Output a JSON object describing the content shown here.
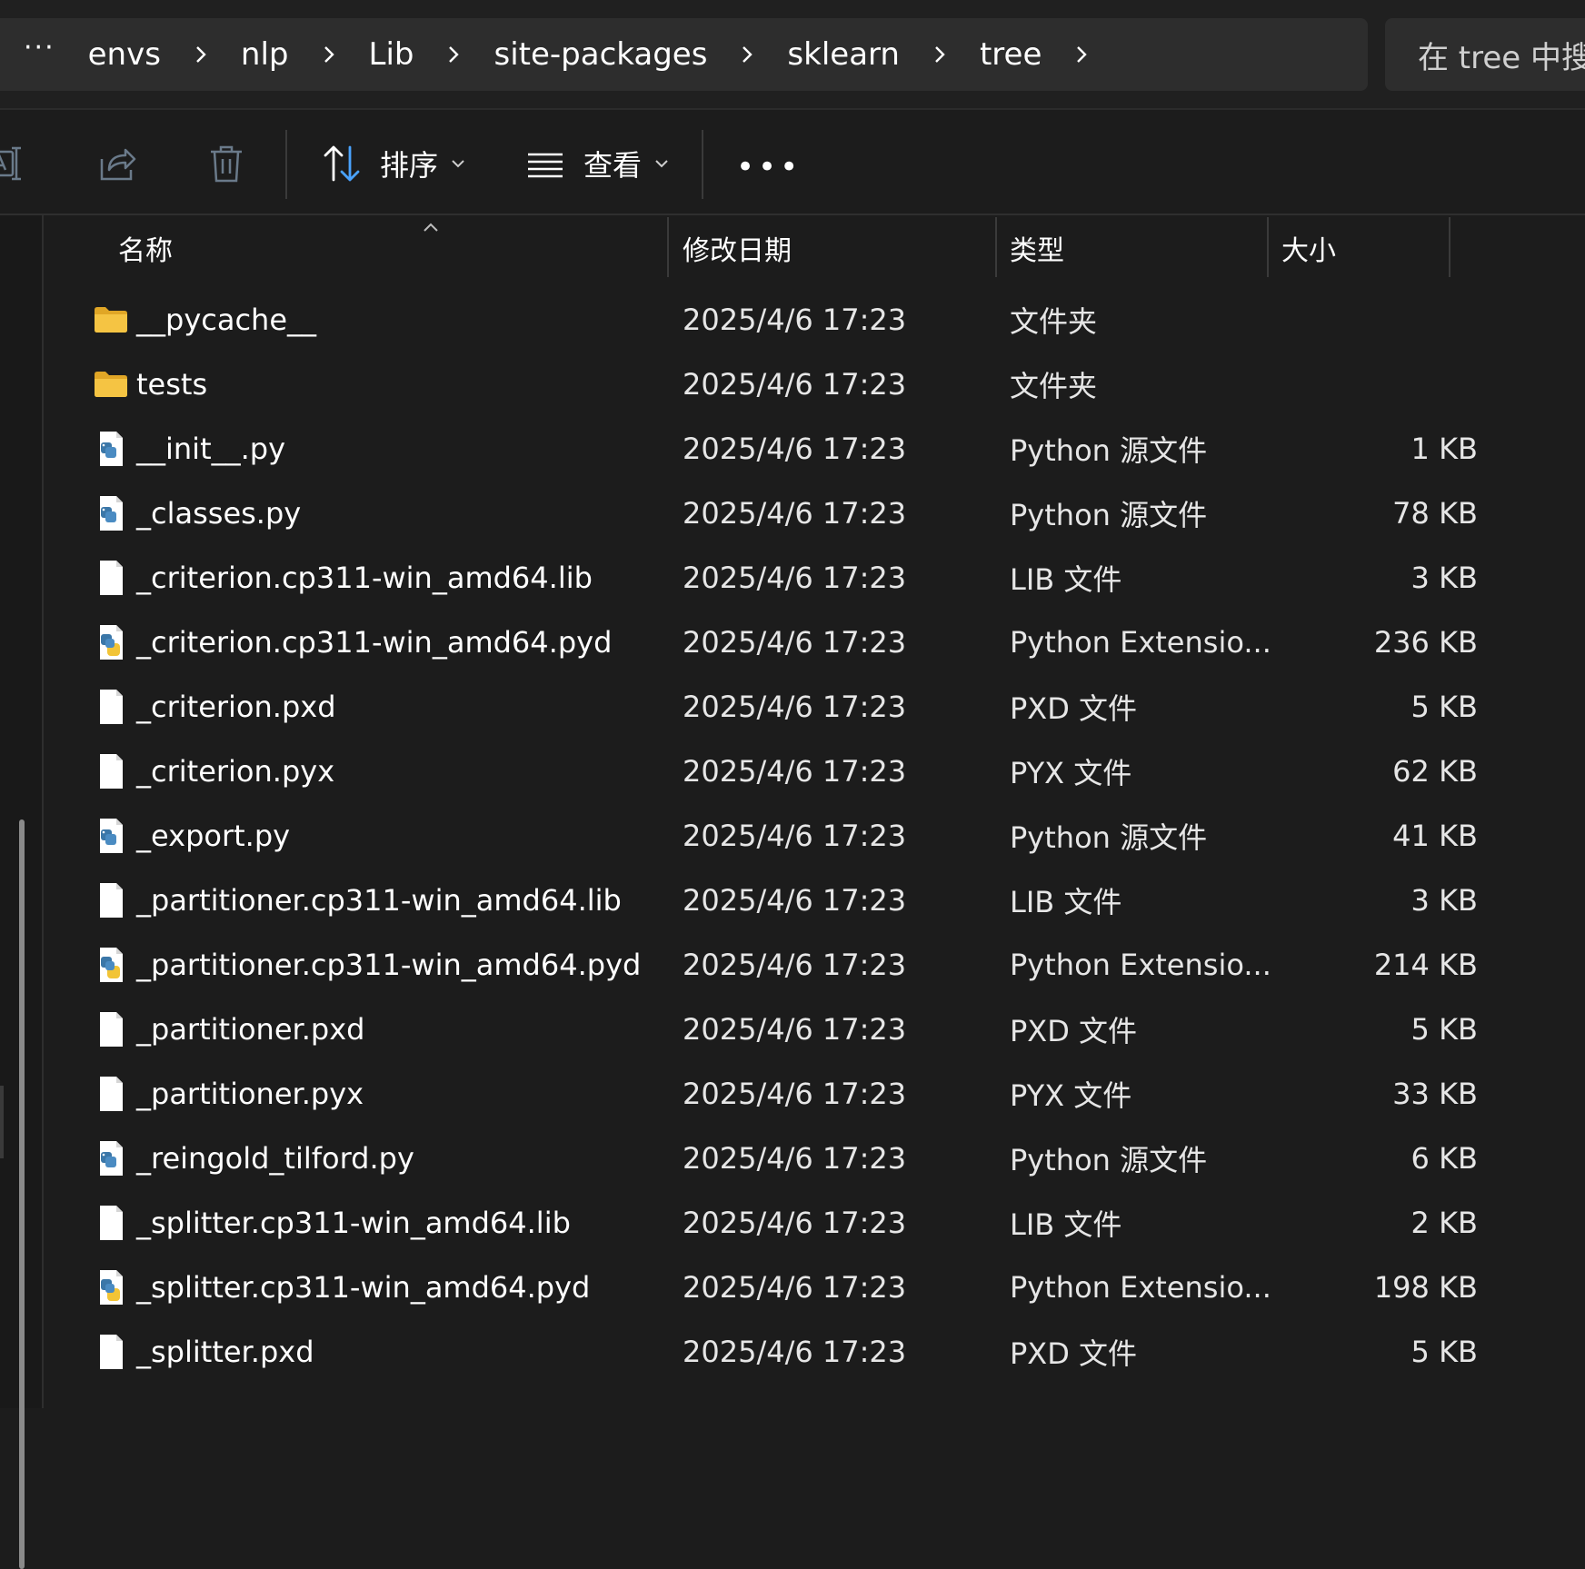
{
  "address_bar": {
    "more_label": "···",
    "breadcrumbs": [
      "envs",
      "nlp",
      "Lib",
      "site-packages",
      "sklearn",
      "tree"
    ],
    "search_placeholder": "在 tree 中搜索"
  },
  "command_bar": {
    "icons": [
      "rename-icon",
      "share-icon",
      "delete-icon"
    ],
    "sort_label": "排序",
    "view_label": "查看",
    "more_label": "•••"
  },
  "columns": {
    "name": "名称",
    "date": "修改日期",
    "type": "类型",
    "size": "大小"
  },
  "files": [
    {
      "icon": "folder",
      "name": "__pycache__",
      "date": "2025/4/6 17:23",
      "type": "文件夹",
      "size": ""
    },
    {
      "icon": "folder",
      "name": "tests",
      "date": "2025/4/6 17:23",
      "type": "文件夹",
      "size": ""
    },
    {
      "icon": "python",
      "name": "__init__.py",
      "date": "2025/4/6 17:23",
      "type": "Python 源文件",
      "size": "1 KB"
    },
    {
      "icon": "python",
      "name": "_classes.py",
      "date": "2025/4/6 17:23",
      "type": "Python 源文件",
      "size": "78 KB"
    },
    {
      "icon": "file",
      "name": "_criterion.cp311-win_amd64.lib",
      "date": "2025/4/6 17:23",
      "type": "LIB 文件",
      "size": "3 KB"
    },
    {
      "icon": "pyd",
      "name": "_criterion.cp311-win_amd64.pyd",
      "date": "2025/4/6 17:23",
      "type": "Python Extensio...",
      "size": "236 KB"
    },
    {
      "icon": "file",
      "name": "_criterion.pxd",
      "date": "2025/4/6 17:23",
      "type": "PXD 文件",
      "size": "5 KB"
    },
    {
      "icon": "file",
      "name": "_criterion.pyx",
      "date": "2025/4/6 17:23",
      "type": "PYX 文件",
      "size": "62 KB"
    },
    {
      "icon": "python",
      "name": "_export.py",
      "date": "2025/4/6 17:23",
      "type": "Python 源文件",
      "size": "41 KB"
    },
    {
      "icon": "file",
      "name": "_partitioner.cp311-win_amd64.lib",
      "date": "2025/4/6 17:23",
      "type": "LIB 文件",
      "size": "3 KB"
    },
    {
      "icon": "pyd",
      "name": "_partitioner.cp311-win_amd64.pyd",
      "date": "2025/4/6 17:23",
      "type": "Python Extensio...",
      "size": "214 KB"
    },
    {
      "icon": "file",
      "name": "_partitioner.pxd",
      "date": "2025/4/6 17:23",
      "type": "PXD 文件",
      "size": "5 KB"
    },
    {
      "icon": "file",
      "name": "_partitioner.pyx",
      "date": "2025/4/6 17:23",
      "type": "PYX 文件",
      "size": "33 KB"
    },
    {
      "icon": "python",
      "name": "_reingold_tilford.py",
      "date": "2025/4/6 17:23",
      "type": "Python 源文件",
      "size": "6 KB"
    },
    {
      "icon": "file",
      "name": "_splitter.cp311-win_amd64.lib",
      "date": "2025/4/6 17:23",
      "type": "LIB 文件",
      "size": "2 KB"
    },
    {
      "icon": "pyd",
      "name": "_splitter.cp311-win_amd64.pyd",
      "date": "2025/4/6 17:23",
      "type": "Python Extensio...",
      "size": "198 KB"
    },
    {
      "icon": "file",
      "name": "_splitter.pxd",
      "date": "2025/4/6 17:23",
      "type": "PXD 文件",
      "size": "5 KB"
    }
  ],
  "colors": {
    "background": "#1c1c1c",
    "bar": "#2d2d2d",
    "folder": "#f5c443",
    "accent": "#4aa3ff"
  }
}
